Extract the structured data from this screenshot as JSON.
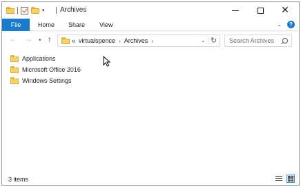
{
  "window": {
    "title": "Archives"
  },
  "quick_access": {
    "icons": [
      "folder-icon",
      "properties-check-icon",
      "new-folder-icon",
      "customize-dropdown-icon"
    ]
  },
  "window_controls": {
    "minimize": "minimize-icon",
    "maximize": "maximize-icon",
    "close": "close-icon"
  },
  "ribbon": {
    "tabs": [
      {
        "label": "File",
        "active": true
      },
      {
        "label": "Home"
      },
      {
        "label": "Share"
      },
      {
        "label": "View"
      }
    ],
    "help_label": "?"
  },
  "nav": {
    "back_icon": "back-arrow-icon",
    "forward_icon": "forward-arrow-icon",
    "recent_icon": "chevron-down-icon",
    "up_icon": "up-arrow-icon"
  },
  "address": {
    "overflow": "«",
    "crumbs": [
      "virtualspence",
      "Archives"
    ],
    "separator": "›"
  },
  "search": {
    "placeholder": "Search Archives"
  },
  "items": [
    {
      "name": "Applications",
      "type": "folder"
    },
    {
      "name": "Microsoft Office 2016",
      "type": "folder"
    },
    {
      "name": "Windows Settings",
      "type": "folder"
    }
  ],
  "status": {
    "count_text": "3 items"
  },
  "colors": {
    "accent": "#1979ca",
    "folder": "#f5d26a"
  }
}
